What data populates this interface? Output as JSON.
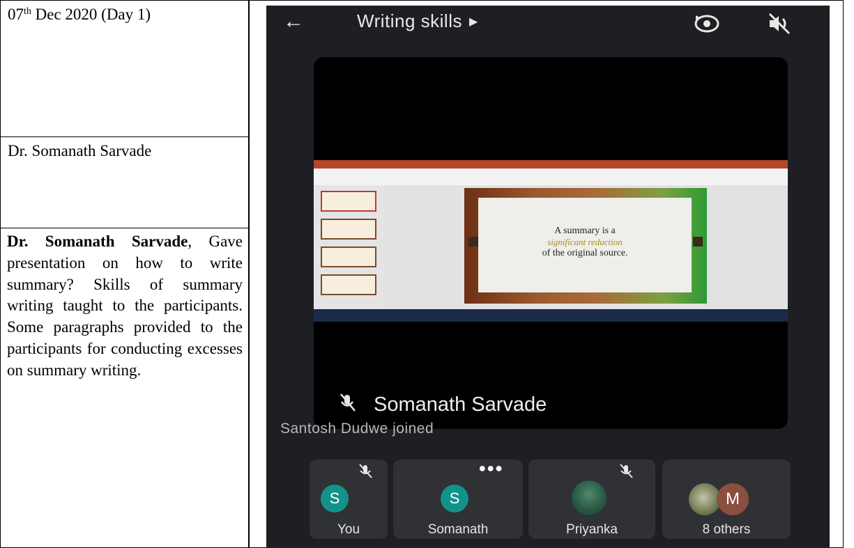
{
  "document": {
    "date_prefix": "07",
    "date_sup": "th",
    "date_rest": " Dec 2020 (Day 1)",
    "speaker_name": "Dr. Somanath Sarvade",
    "description_bold": "Dr. Somanath Sarvade",
    "description_rest": ", Gave presentation on how to write summary? Skills of summary writing taught to the participants. Some paragraphs provided to the participants for conducting excesses on summary writing."
  },
  "meeting": {
    "title": "Writing skills",
    "active_speaker": "Somanath Sarvade",
    "notification": "Santosh Dudwe joined",
    "slide": {
      "line1": "A summary is a",
      "line2": "significant reduction",
      "line3": "of the original source."
    },
    "participants": [
      {
        "initial": "S",
        "label": "You"
      },
      {
        "initial": "S",
        "label": "Somanath"
      },
      {
        "label": "Priyanka"
      },
      {
        "initial": "M",
        "label": "8 others"
      }
    ]
  }
}
